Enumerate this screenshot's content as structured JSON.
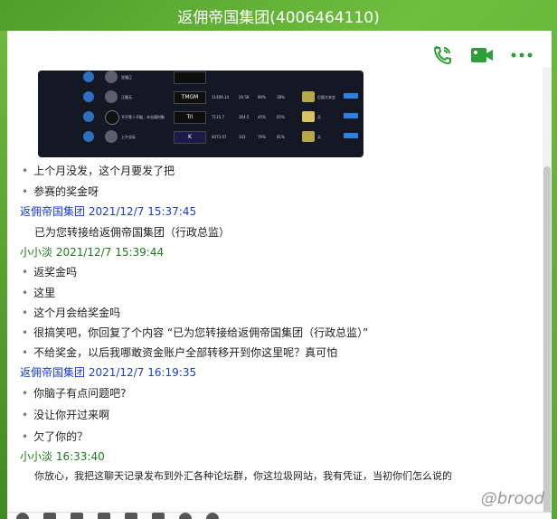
{
  "window": {
    "title": "返佣帝国集团(4006464110)"
  },
  "toolbar": {
    "call_icon": "phone-icon",
    "video_icon": "video-camera-icon",
    "more_icon": "more-icon"
  },
  "screenshot_preview": {
    "rows": [
      {
        "name": "亚隆辽",
        "logo": "",
        "n1": "",
        "n2": "",
        "n3": "",
        "n4": "",
        "right": ""
      },
      {
        "name": "汪隆无",
        "logo": "TMGM",
        "n1": "11409.14",
        "n2": "20.58",
        "n3": "80%",
        "n4": "38%",
        "right": "后援大本金"
      },
      {
        "name": "不不等人不能、辛苦随时聚",
        "logo": "Tri",
        "n1": "7115.7",
        "n2": "364.5",
        "n3": "45%",
        "n4": "65%",
        "right": "天"
      },
      {
        "name": "上午交际",
        "logo": "K",
        "n1": "4073.07",
        "n2": "102",
        "n3": "79%",
        "n4": "81%",
        "right": "天"
      }
    ]
  },
  "messages": [
    {
      "type": "text",
      "text": "上个月没发，这个月要发了把"
    },
    {
      "type": "text",
      "text": "参赛的奖金呀"
    },
    {
      "type": "header",
      "sender": "返佣帝国集团",
      "time": "2021/12/7 15:37:45",
      "color": "blue"
    },
    {
      "type": "plain",
      "text": "已为您转接给返佣帝国集团（行政总监）"
    },
    {
      "type": "header",
      "sender": "小小淡",
      "time": "2021/12/7 15:39:44",
      "color": "green"
    },
    {
      "type": "text",
      "text": "返奖金吗"
    },
    {
      "type": "text",
      "text": "这里"
    },
    {
      "type": "text",
      "text": "这个月会给奖金吗"
    },
    {
      "type": "text",
      "text": "很搞笑吧，你回复了个内容 “已为您转接给返佣帝国集团（行政总监）”"
    },
    {
      "type": "text",
      "text": "不给奖金，以后我哪敢资金账户全部转移开到你这里呢？真可怕"
    },
    {
      "type": "header",
      "sender": "返佣帝国集团",
      "time": "2021/12/7 16:19:35",
      "color": "blue"
    },
    {
      "type": "text",
      "text": "你脑子有点问题吧?"
    },
    {
      "type": "text",
      "text": "没让你开过来啊"
    },
    {
      "type": "text",
      "text": "欠了你的？"
    },
    {
      "type": "header",
      "sender": "小小淡",
      "time": "16:33:40",
      "color": "green"
    },
    {
      "type": "plain",
      "text": "你放心，我把这聊天记录发布到外汇各种论坛群，你这垃圾网站，我有凭证，当初你们怎么说的"
    }
  ],
  "watermark": "@brood"
}
